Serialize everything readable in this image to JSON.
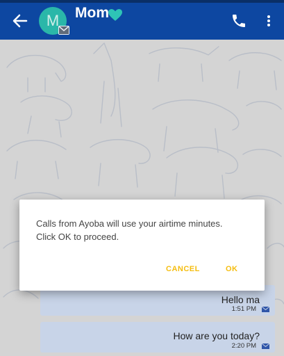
{
  "header": {
    "avatar_letter": "M",
    "title": "Mom"
  },
  "dialog": {
    "message_line1": "Calls from Ayoba will use your airtime minutes.",
    "message_line2": "Click OK to proceed.",
    "cancel_label": "CANCEL",
    "ok_label": "OK"
  },
  "messages": [
    {
      "text": "Hello ma",
      "time": "1:51 PM"
    },
    {
      "text": "How are you today?",
      "time": "2:20 PM"
    }
  ],
  "colors": {
    "app_bar": "#0d47a1",
    "avatar": "#2ab7a9",
    "heart": "#2ec4b6",
    "dialog_button": "#f5bd0f",
    "bubble": "#c8d4e8"
  },
  "icons": {
    "back": "arrow-back-icon",
    "badge": "envelope-icon",
    "heart": "heart-icon",
    "call": "phone-icon",
    "menu": "more-vert-icon",
    "message_status": "envelope-icon"
  }
}
